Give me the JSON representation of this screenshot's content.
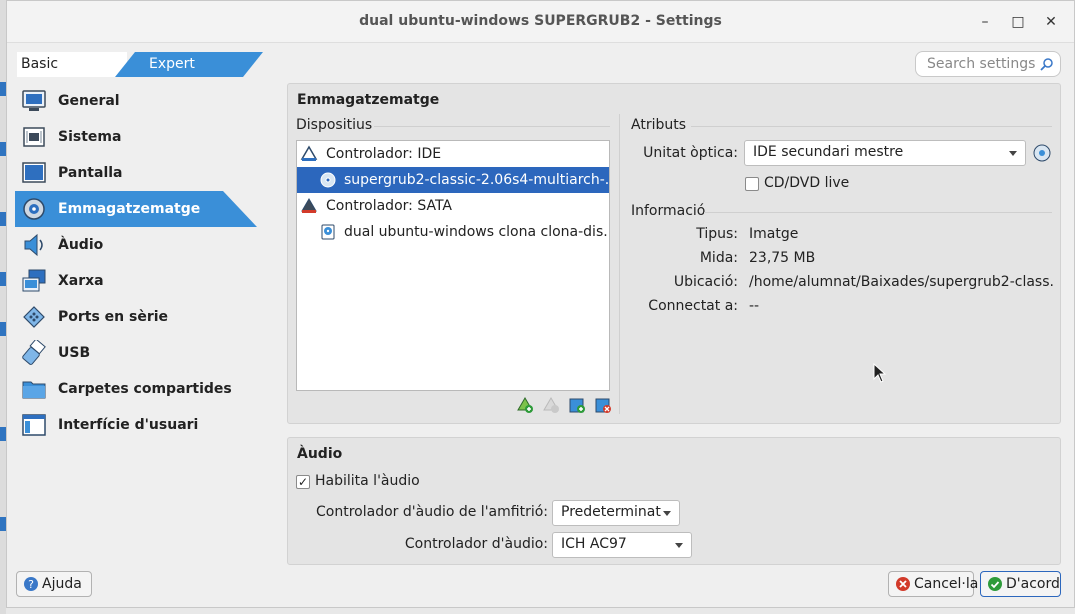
{
  "window": {
    "title": "dual ubuntu-windows SUPERGRUB2 - Settings",
    "controls": {
      "minimize": "–",
      "maximize": "□",
      "close": "✕"
    }
  },
  "mode_tabs": {
    "basic": "Basic",
    "expert": "Expert",
    "selected": "Expert"
  },
  "search": {
    "placeholder": "Search settings"
  },
  "sidebar": {
    "selected": "Emmagatzematge",
    "items": [
      {
        "label": "General",
        "icon": "monitor-icon"
      },
      {
        "label": "Sistema",
        "icon": "chip-icon"
      },
      {
        "label": "Pantalla",
        "icon": "display-icon"
      },
      {
        "label": "Emmagatzematge",
        "icon": "storage-disk-icon"
      },
      {
        "label": "Àudio",
        "icon": "speaker-icon"
      },
      {
        "label": "Xarxa",
        "icon": "network-icon"
      },
      {
        "label": "Ports en sèrie",
        "icon": "serial-port-icon"
      },
      {
        "label": "USB",
        "icon": "usb-icon"
      },
      {
        "label": "Carpetes compartides",
        "icon": "folder-icon"
      },
      {
        "label": "Interfície d'usuari",
        "icon": "user-interface-icon"
      }
    ]
  },
  "storage": {
    "title": "Emmagatzematge",
    "devices_label": "Dispositius",
    "tree": [
      {
        "label": "Controlador: IDE",
        "level": 0,
        "icon": "ide-controller-icon"
      },
      {
        "label": "supergrub2-classic-2.06s4-multiarch-...",
        "level": 1,
        "icon": "optical-disc-icon",
        "selected": true
      },
      {
        "label": "Controlador: SATA",
        "level": 0,
        "icon": "sata-controller-icon"
      },
      {
        "label": "dual ubuntu-windows clona clona-dis...",
        "level": 1,
        "icon": "hard-disk-icon"
      }
    ],
    "attributes": {
      "label": "Atributs",
      "optical_drive_label": "Unitat òptica:",
      "optical_drive_value": "IDE secundari mestre",
      "live_cd_label": "CD/DVD live",
      "live_cd_checked": false
    },
    "info": {
      "label": "Informació",
      "rows": [
        {
          "key": "Tipus:",
          "value": "Imatge"
        },
        {
          "key": "Mida:",
          "value": "23,75 MB"
        },
        {
          "key": "Ubicació:",
          "value": "/home/alumnat/Baixades/supergrub2-class..."
        },
        {
          "key": "Connectat a:",
          "value": "--"
        }
      ]
    }
  },
  "audio": {
    "title": "Àudio",
    "enable_label": "Habilita l'àudio",
    "enabled": true,
    "host_driver_label": "Controlador d'àudio de l'amfitrió:",
    "host_driver_value": "Predeterminat",
    "controller_label": "Controlador d'àudio:",
    "controller_value": "ICH AC97"
  },
  "buttons": {
    "help": "Ajuda",
    "cancel": "Cancel·la",
    "ok": "D'acord"
  },
  "colors": {
    "accent": "#2c67bd",
    "selection_arrow": "#3a8fd8",
    "ok_icon": "#2e9b3a",
    "cancel_icon": "#d23a2a"
  }
}
